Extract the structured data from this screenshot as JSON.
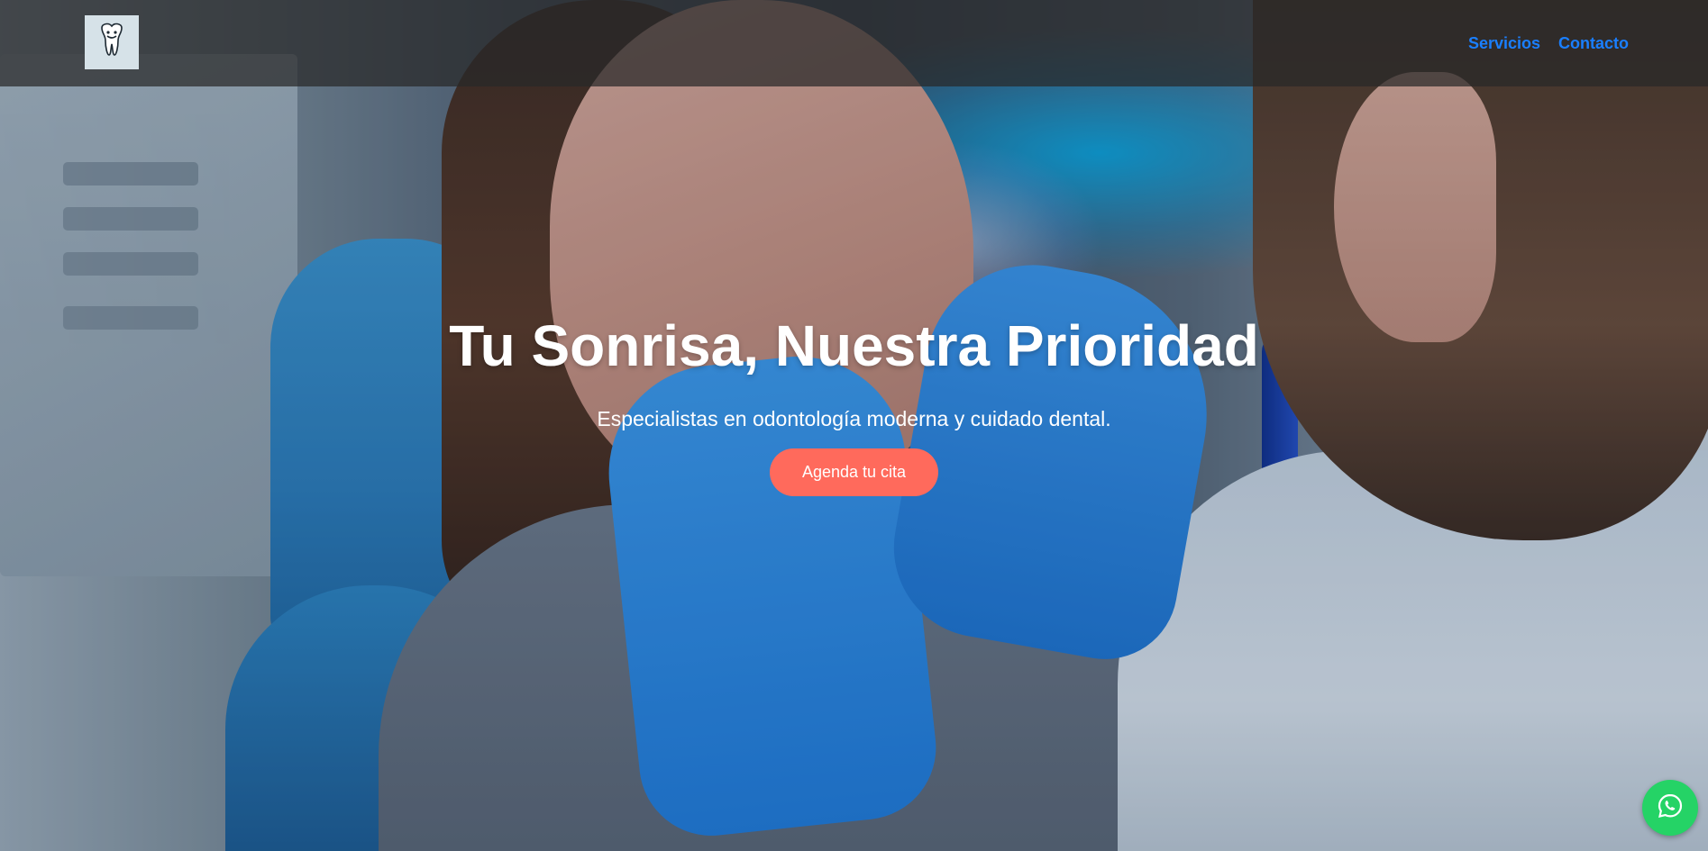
{
  "header": {
    "logo_icon": "tooth-logo-icon",
    "nav": [
      {
        "label": "Servicios"
      },
      {
        "label": "Contacto"
      }
    ]
  },
  "hero": {
    "title": "Tu Sonrisa, Nuestra Prioridad",
    "subtitle": "Especialistas en odontología moderna y cuidado dental.",
    "cta_label": "Agenda tu cita"
  },
  "floating": {
    "whatsapp_icon": "whatsapp-icon"
  },
  "colors": {
    "nav_link": "#1a7fff",
    "cta_bg": "#ff6a5c",
    "whatsapp": "#25d366",
    "header_bg": "rgba(40,40,40,0.72)"
  }
}
